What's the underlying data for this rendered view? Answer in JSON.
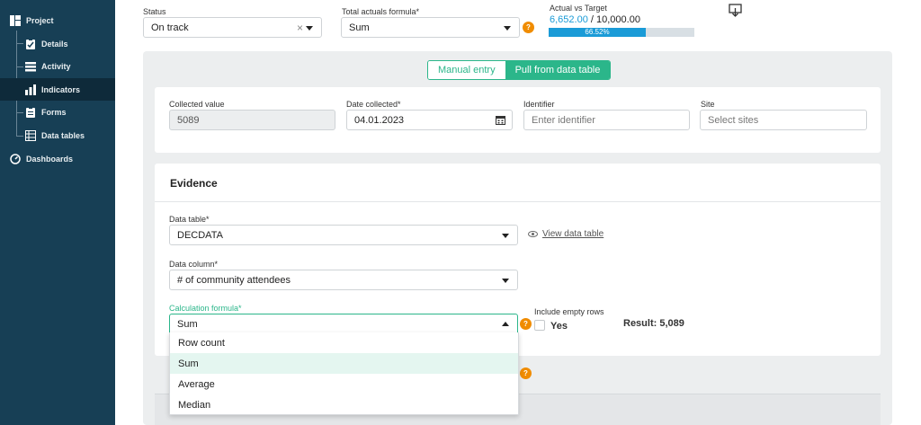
{
  "sidebar": {
    "items": [
      {
        "label": "Project",
        "icon": "project-icon"
      },
      {
        "label": "Details",
        "icon": "clipboard-icon"
      },
      {
        "label": "Activity",
        "icon": "list-icon"
      },
      {
        "label": "Indicators",
        "icon": "bar-chart-icon"
      },
      {
        "label": "Forms",
        "icon": "form-icon"
      },
      {
        "label": "Data tables",
        "icon": "table-icon"
      },
      {
        "label": "Dashboards",
        "icon": "gauge-icon"
      }
    ],
    "active": "Indicators",
    "colors": {
      "bg": "#173f55",
      "active_bg": "#0e2a3a"
    }
  },
  "header": {
    "status_label": "Status",
    "status_value": "On track",
    "formula_label": "Total actuals formula*",
    "formula_value": "Sum",
    "progress": {
      "label": "Actual vs Target",
      "actual": "6,652.00",
      "separator": " / ",
      "target": "10,000.00",
      "percent_text": "66.52%",
      "fraction": 0.6652,
      "color": "#1a9bd7"
    }
  },
  "toggle": {
    "manual": "Manual entry",
    "pull": "Pull from data table",
    "selected": "Pull from data table",
    "accent": "#2bb68a"
  },
  "entry": {
    "collected_value_label": "Collected value",
    "collected_value": "5089",
    "date_label": "Date collected*",
    "date_value": "04.01.2023",
    "identifier_label": "Identifier",
    "identifier_placeholder": "Enter identifier",
    "site_label": "Site",
    "site_placeholder": "Select sites"
  },
  "evidence": {
    "title": "Evidence",
    "data_table_label": "Data table*",
    "data_table_value": "DECDATA",
    "view_link": "View data table",
    "data_column_label": "Data column*",
    "data_column_value": "# of community attendees",
    "calc_label": "Calculation formula*",
    "calc_value": "Sum",
    "include_empty_label": "Include empty rows",
    "include_empty_option": "Yes",
    "result": "Result: 5,089",
    "calc_options": [
      "Row count",
      "Sum",
      "Average",
      "Median"
    ],
    "highlighted_option": "Sum"
  },
  "help_icon_text": "?"
}
